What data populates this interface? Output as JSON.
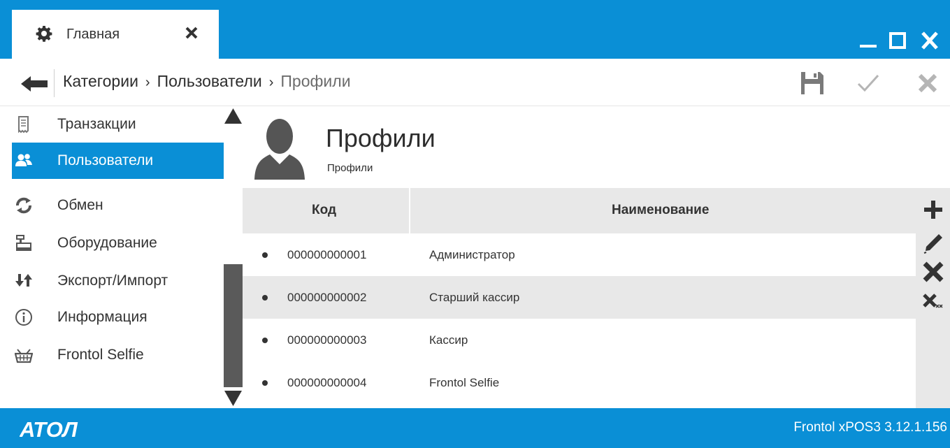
{
  "window": {
    "tab_title": "Главная",
    "tab_icon": "gear-icon",
    "controls": [
      "minimize-icon",
      "maximize-icon",
      "close-icon"
    ]
  },
  "breadcrumb": {
    "items": [
      "Категории",
      "Пользователи"
    ],
    "current": "Профили"
  },
  "toolbar": {
    "buttons": [
      "save-icon",
      "check-icon",
      "cancel-icon"
    ]
  },
  "sidebar": {
    "items": [
      {
        "label": "Транзакции",
        "icon": "receipt-icon",
        "active": false
      },
      {
        "label": "Пользователи",
        "icon": "users-icon",
        "active": true
      },
      {
        "label": "Обмен",
        "icon": "sync-icon",
        "active": false
      },
      {
        "label": "Оборудование",
        "icon": "cash-register-icon",
        "active": false
      },
      {
        "label": "Экспорт/Импорт",
        "icon": "export-import-icon",
        "active": false
      },
      {
        "label": "Информация",
        "icon": "info-icon",
        "active": false
      },
      {
        "label": "Frontol Selfie",
        "icon": "basket-icon",
        "active": false
      }
    ]
  },
  "page": {
    "title": "Профили",
    "subtitle": "Профили",
    "icon": "user-avatar-icon"
  },
  "table": {
    "columns": [
      "Код",
      "Наименование"
    ],
    "rows": [
      {
        "code": "000000000001",
        "name": "Администратор"
      },
      {
        "code": "000000000002",
        "name": "Старший кассир"
      },
      {
        "code": "000000000003",
        "name": "Кассир"
      },
      {
        "code": "000000000004",
        "name": "Frontol Selfie"
      }
    ]
  },
  "side_actions": [
    "add-icon",
    "edit-icon",
    "delete-icon",
    "delete-all-icon"
  ],
  "footer": {
    "brand": "АТОЛ",
    "version": "Frontol xPOS3 3.12.1.156"
  },
  "colors": {
    "accent": "#0a8fd6",
    "active_item": "#0a8fd6",
    "row_alt": "#e8e8e8",
    "scroll_thumb": "#5a5a5a"
  }
}
